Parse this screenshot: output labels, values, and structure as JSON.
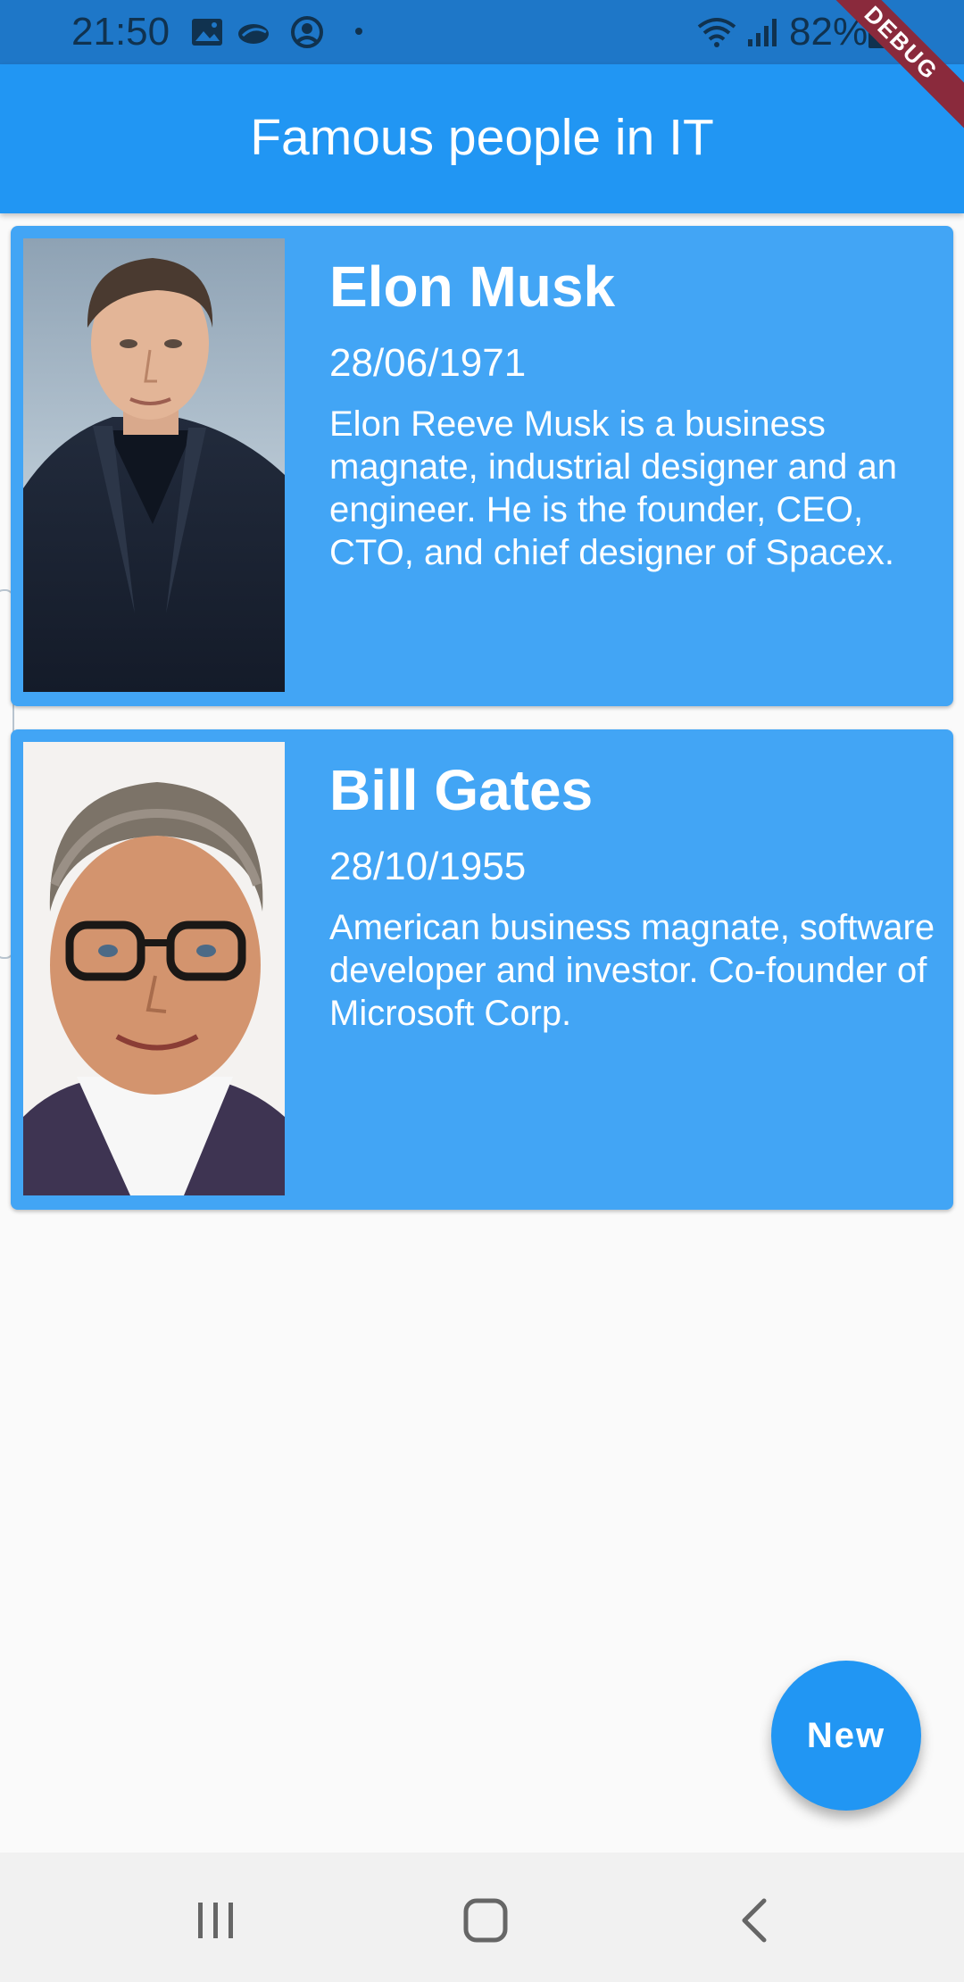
{
  "status_bar": {
    "time": "21:50",
    "battery": "82%",
    "icons": [
      "image-icon",
      "cloud-icon",
      "account-circle-icon",
      "wifi-icon",
      "signal-icon",
      "battery-icon"
    ]
  },
  "debug_banner": "DEBUG",
  "app_bar": {
    "title": "Famous people in IT",
    "color": "#2196f3"
  },
  "people": [
    {
      "name": "Elon Musk",
      "date": "28/06/1971",
      "description": "Elon Reeve Musk is a business magnate, industrial designer and an engineer. He is the founder, CEO, CTO, and chief designer of Spacex."
    },
    {
      "name": "Bill Gates",
      "date": "28/10/1955",
      "description": "American business magnate, software developer and investor. Co-founder of Microsoft Corp."
    }
  ],
  "fab": {
    "label": "New"
  },
  "nav_bar": {
    "buttons": [
      "recent-apps-icon",
      "home-icon",
      "back-icon"
    ]
  },
  "colors": {
    "status_bar": "#1e77c8",
    "card": "#42a5f5",
    "background": "#fafafa"
  }
}
